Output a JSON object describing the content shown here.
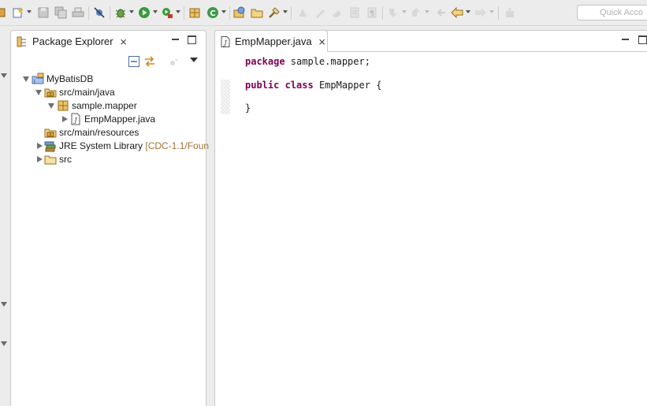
{
  "toolbar": {
    "search_placeholder": "Quick Acco"
  },
  "package_explorer": {
    "title": "Package Explorer",
    "tree": [
      {
        "label": "MyBatisDB",
        "decoration": "",
        "state": "open"
      },
      {
        "label": "src/main/java",
        "decoration": "",
        "state": "open"
      },
      {
        "label": "sample.mapper",
        "decoration": "",
        "state": "open"
      },
      {
        "label": "EmpMapper.java",
        "decoration": "",
        "state": "closed"
      },
      {
        "label": "src/main/resources",
        "decoration": "",
        "state": "none"
      },
      {
        "label": "JRE System Library",
        "decoration": "[CDC-1.1/Foun",
        "state": "closed"
      },
      {
        "label": "src",
        "decoration": "",
        "state": "closed"
      }
    ]
  },
  "editor": {
    "tab_label": "EmpMapper.java",
    "code": {
      "line1_keyword": "package",
      "line1_rest": " sample.mapper;",
      "line2_kw1": "public",
      "line2_kw2": "class",
      "line2_rest": " EmpMapper {",
      "line3": "}"
    }
  },
  "colors": {
    "keyword": "#7f0055",
    "decoration": "#a07437",
    "background": "#ececec"
  },
  "icons": [
    "new-wizard-icon",
    "save-icon",
    "save-all-icon",
    "print-icon",
    "skip-breakpoints-icon",
    "debug-icon",
    "run-icon",
    "external-tools-icon",
    "new-package-icon",
    "new-class-icon",
    "open-type-icon",
    "open-folder-icon",
    "search-icon",
    "collapse-all-icon",
    "link-editor-icon",
    "package-icon",
    "java-file-icon",
    "jar-library-icon",
    "folder-icon",
    "project-icon"
  ]
}
